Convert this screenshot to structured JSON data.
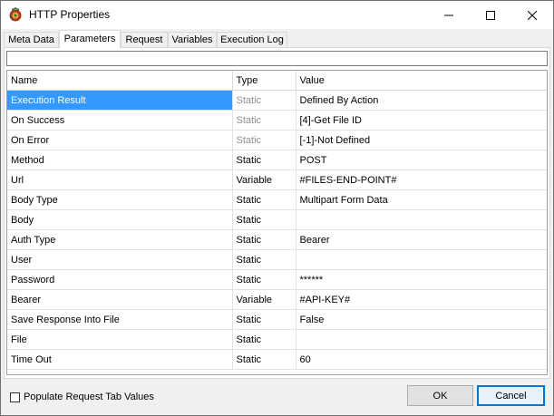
{
  "window": {
    "title": "HTTP Properties"
  },
  "icons": {
    "app": "http-properties-app-icon",
    "minimize": "minimize-icon",
    "maximize": "maximize-icon",
    "close": "close-icon"
  },
  "tabs": [
    {
      "label": "Meta Data",
      "active": false
    },
    {
      "label": "Parameters",
      "active": true
    },
    {
      "label": "Request",
      "active": false
    },
    {
      "label": "Variables",
      "active": false
    },
    {
      "label": "Execution Log",
      "active": false
    }
  ],
  "filter": {
    "value": ""
  },
  "grid": {
    "headers": {
      "name": "Name",
      "type": "Type",
      "value": "Value"
    },
    "rows": [
      {
        "name": "Execution Result",
        "type": "Static",
        "value": "Defined By Action",
        "selected": true,
        "type_dim": true
      },
      {
        "name": "On Success",
        "type": "Static",
        "value": "[4]-Get File ID",
        "selected": false,
        "type_dim": true
      },
      {
        "name": "On Error",
        "type": "Static",
        "value": "[-1]-Not Defined",
        "selected": false,
        "type_dim": true
      },
      {
        "name": "Method",
        "type": "Static",
        "value": "POST",
        "selected": false,
        "type_dim": false
      },
      {
        "name": "Url",
        "type": "Variable",
        "value": "#FILES-END-POINT#",
        "selected": false,
        "type_dim": false
      },
      {
        "name": "Body Type",
        "type": "Static",
        "value": "Multipart Form Data",
        "selected": false,
        "type_dim": false
      },
      {
        "name": "Body",
        "type": "Static",
        "value": "",
        "selected": false,
        "type_dim": false
      },
      {
        "name": "Auth Type",
        "type": "Static",
        "value": "Bearer",
        "selected": false,
        "type_dim": false
      },
      {
        "name": "User",
        "type": "Static",
        "value": "",
        "selected": false,
        "type_dim": false
      },
      {
        "name": "Password",
        "type": "Static",
        "value": "******",
        "selected": false,
        "type_dim": false
      },
      {
        "name": "Bearer",
        "type": "Variable",
        "value": "#API-KEY#",
        "selected": false,
        "type_dim": false
      },
      {
        "name": "Save Response Into File",
        "type": "Static",
        "value": "False",
        "selected": false,
        "type_dim": false
      },
      {
        "name": "File",
        "type": "Static",
        "value": "",
        "selected": false,
        "type_dim": false
      },
      {
        "name": "Time Out",
        "type": "Static",
        "value": "60",
        "selected": false,
        "type_dim": false
      }
    ]
  },
  "footer": {
    "checkbox_label": "Populate Request Tab Values",
    "checkbox_checked": false,
    "ok_label": "OK",
    "cancel_label": "Cancel"
  },
  "colors": {
    "selection": "#3399ff",
    "default_button_border": "#0078d7",
    "dim_text": "#909090"
  }
}
